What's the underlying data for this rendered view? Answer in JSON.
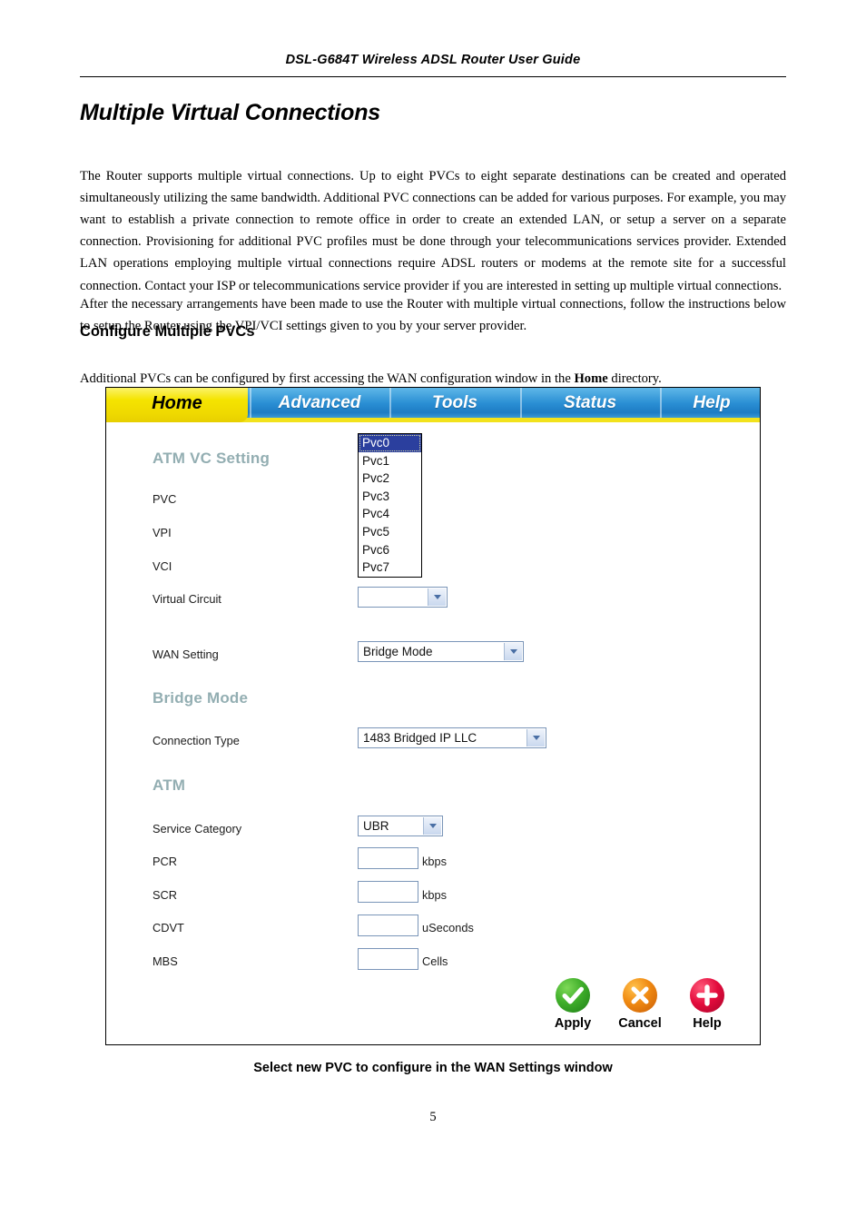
{
  "document": {
    "running_header": "DSL-G684T Wireless ADSL Router User Guide",
    "title": "Multiple Virtual Connections",
    "paragraph_1": "The Router supports multiple virtual connections. Up to eight PVCs to eight separate destinations can be created and operated simultaneously utilizing the same bandwidth. Additional PVC connections can be added for various purposes. For example, you may want to establish a private connection to remote office in order to create an extended LAN, or setup a server on a separate connection. Provisioning for additional PVC profiles must be done through your telecommunications services provider. Extended LAN operations employing multiple virtual connections require ADSL routers or modems at the remote site for a successful connection. Contact your ISP or telecommunications service provider if you are interested in setting up multiple virtual connections.",
    "paragraph_2": "After the necessary arrangements have been made to use the Router with multiple virtual connections, follow the instructions below to setup the Router using the VPI/VCI settings given to you by your server provider.",
    "subheading": "Configure Multiple PVCs",
    "paragraph_3_before": "Additional PVCs can be configured by first accessing the WAN configuration window in the ",
    "paragraph_3_bold": "Home",
    "paragraph_3_after": " directory.",
    "figure_caption": "Select new PVC to configure in the WAN Settings window",
    "page_number": "5"
  },
  "router_ui": {
    "nav_tabs": [
      {
        "label": "Home",
        "active": true
      },
      {
        "label": "Advanced",
        "active": false
      },
      {
        "label": "Tools",
        "active": false
      },
      {
        "label": "Status",
        "active": false
      },
      {
        "label": "Help",
        "active": false
      }
    ],
    "sections": {
      "atm_vc_setting": {
        "heading": "ATM VC Setting",
        "fields": {
          "pvc_label": "PVC",
          "pvc_value": "Pvc0",
          "vpi_label": "VPI",
          "vci_label": "VCI",
          "virtual_circuit_label": "Virtual Circuit",
          "wan_setting_label": "WAN Setting",
          "wan_setting_value": "Bridge Mode"
        },
        "pvc_dropdown_open": true,
        "pvc_options": [
          "Pvc0",
          "Pvc1",
          "Pvc2",
          "Pvc3",
          "Pvc4",
          "Pvc5",
          "Pvc6",
          "Pvc7"
        ],
        "pvc_selected_index": 0
      },
      "bridge_mode": {
        "heading": "Bridge Mode",
        "connection_type_label": "Connection Type",
        "connection_type_value": "1483 Bridged IP LLC"
      },
      "atm": {
        "heading": "ATM",
        "service_category_label": "Service Category",
        "service_category_value": "UBR",
        "rows": [
          {
            "label": "PCR",
            "value": "",
            "unit": "kbps"
          },
          {
            "label": "SCR",
            "value": "",
            "unit": "kbps"
          },
          {
            "label": "CDVT",
            "value": "",
            "unit": "uSeconds"
          },
          {
            "label": "MBS",
            "value": "",
            "unit": "Cells"
          }
        ]
      }
    },
    "actions": [
      {
        "label": "Apply",
        "icon": "check-circle-icon",
        "color": "#3fae2a"
      },
      {
        "label": "Cancel",
        "icon": "x-circle-icon",
        "color": "#f08a12"
      },
      {
        "label": "Help",
        "icon": "plus-circle-icon",
        "color": "#e30b3c"
      }
    ],
    "colors": {
      "active_tab": "#f5e400",
      "tab_bar": "#2a8fd4",
      "section_heading": "#93aeb2",
      "dropdown_highlight": "#2b3f9e"
    }
  }
}
